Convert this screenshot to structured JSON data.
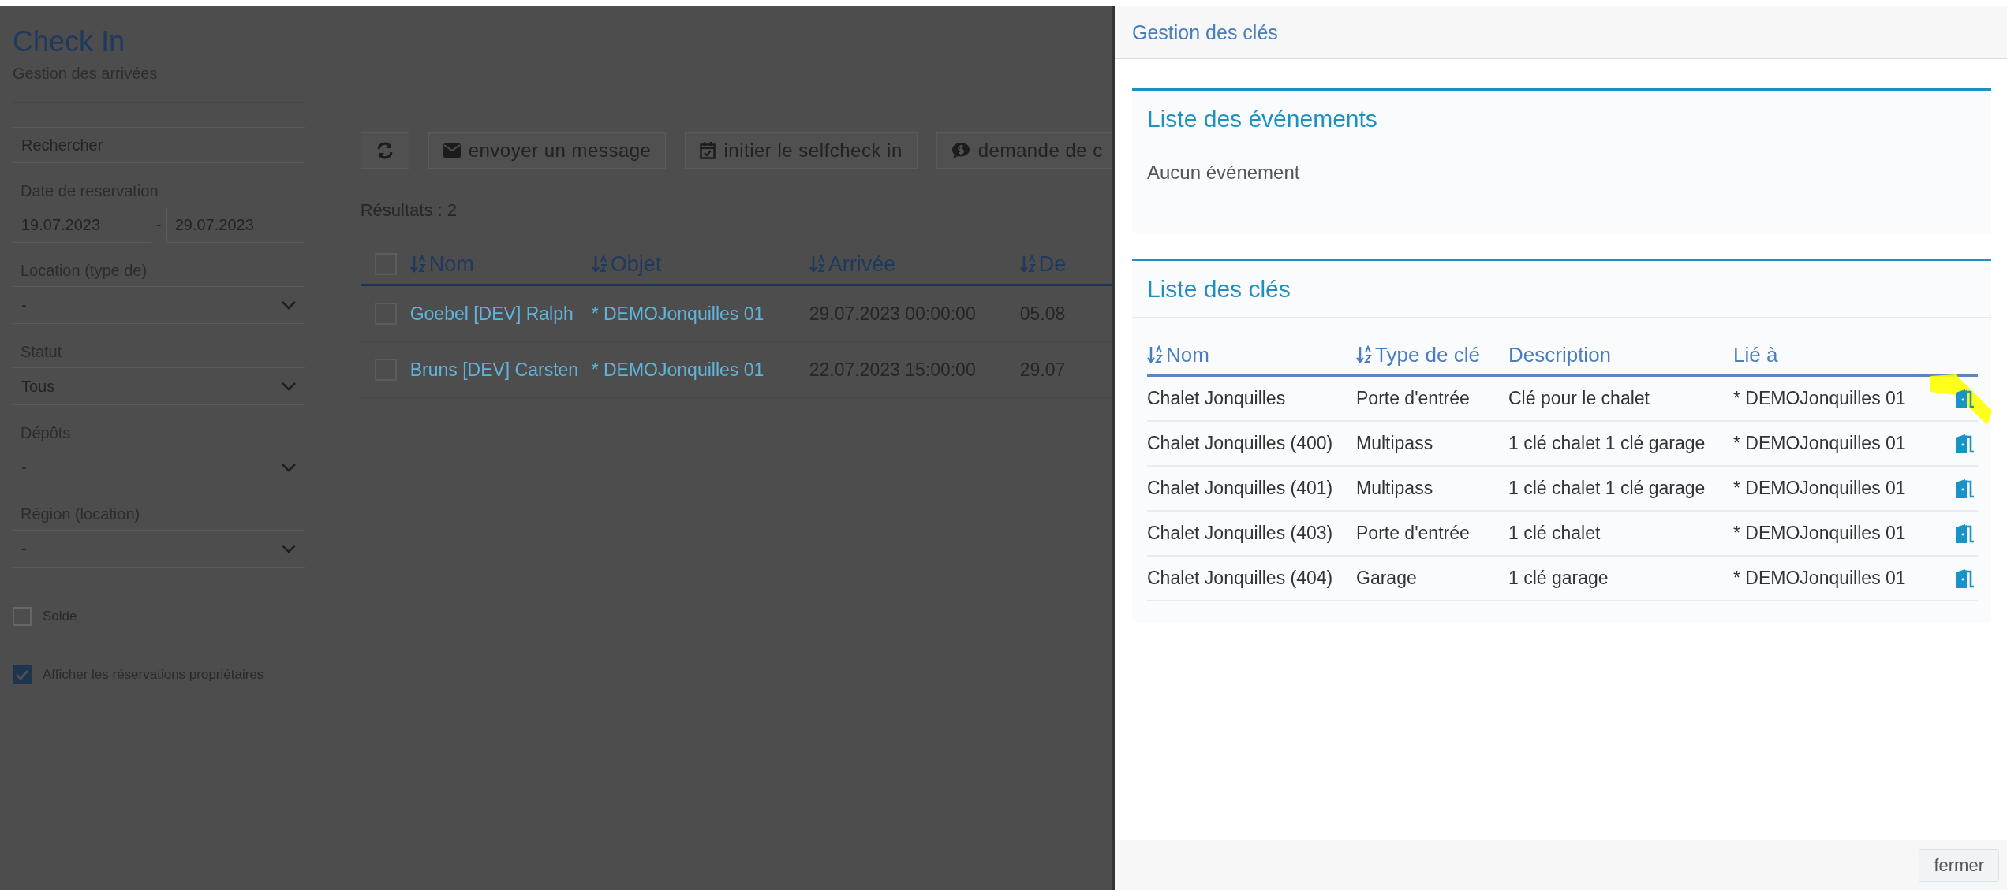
{
  "page": {
    "title": "Check In",
    "subtitle": "Gestion des arrivées"
  },
  "filters": {
    "search": {
      "placeholder": "Rechercher"
    },
    "date": {
      "label": "Date de reservation",
      "from": "19.07.2023",
      "separator": "-",
      "to": "29.07.2023"
    },
    "selects": [
      {
        "label": "Location (type de)",
        "value": "-"
      },
      {
        "label": "Statut",
        "value": "Tous"
      },
      {
        "label": "Dépôts",
        "value": "-"
      },
      {
        "label": "Région (location)",
        "value": "-"
      }
    ],
    "checkboxes": [
      {
        "label": "Solde",
        "checked": false
      },
      {
        "label": "Afficher les réservations propriétaires",
        "checked": true
      }
    ]
  },
  "toolbar": [
    {
      "kind": "refresh"
    },
    {
      "kind": "envelope",
      "label": "envoyer un message"
    },
    {
      "kind": "calendar",
      "label": "initier le selfcheck in"
    },
    {
      "kind": "money",
      "label": "demande de c"
    }
  ],
  "results": "Résultats : 2",
  "table": {
    "select_all_checked": false,
    "columns": [
      "Nom",
      "Objet",
      "Arrivée",
      "De"
    ],
    "rows": [
      {
        "checked": false,
        "cells": [
          "Goebel [DEV] Ralph",
          "* DEMOJonquilles 01",
          "29.07.2023 00:00:00",
          "05.08"
        ]
      },
      {
        "checked": false,
        "cells": [
          "Bruns [DEV] Carsten",
          "* DEMOJonquilles 01",
          "22.07.2023 15:00:00",
          "29.07"
        ]
      }
    ]
  },
  "dialog": {
    "title": "Gestion des clés",
    "events": {
      "title": "Liste des événements",
      "empty": "Aucun événement"
    },
    "keys": {
      "title": "Liste des clés",
      "columns": [
        {
          "label": "Nom",
          "sortable": true
        },
        {
          "label": "Type de clé",
          "sortable": true
        },
        {
          "label": "Description",
          "sortable": false
        },
        {
          "label": "Lié à",
          "sortable": false
        }
      ],
      "rows": [
        {
          "cells": [
            "Chalet Jonquilles",
            "Porte d'entrée",
            "Clé pour le chalet",
            "* DEMOJonquilles 01"
          ],
          "highlighted": true
        },
        {
          "cells": [
            "Chalet Jonquilles (400)",
            "Multipass",
            "1 clé chalet 1 clé garage",
            "* DEMOJonquilles 01"
          ],
          "highlighted": false
        },
        {
          "cells": [
            "Chalet Jonquilles (401)",
            "Multipass",
            "1 clé chalet 1 clé garage",
            "* DEMOJonquilles 01"
          ],
          "highlighted": false
        },
        {
          "cells": [
            "Chalet Jonquilles (403)",
            "Porte d'entrée",
            "1 clé chalet",
            "* DEMOJonquilles 01"
          ],
          "highlighted": false
        },
        {
          "cells": [
            "Chalet Jonquilles (404)",
            "Garage",
            "1 clé garage",
            "* DEMOJonquilles 01"
          ],
          "highlighted": false
        }
      ]
    },
    "close": "fermer"
  }
}
